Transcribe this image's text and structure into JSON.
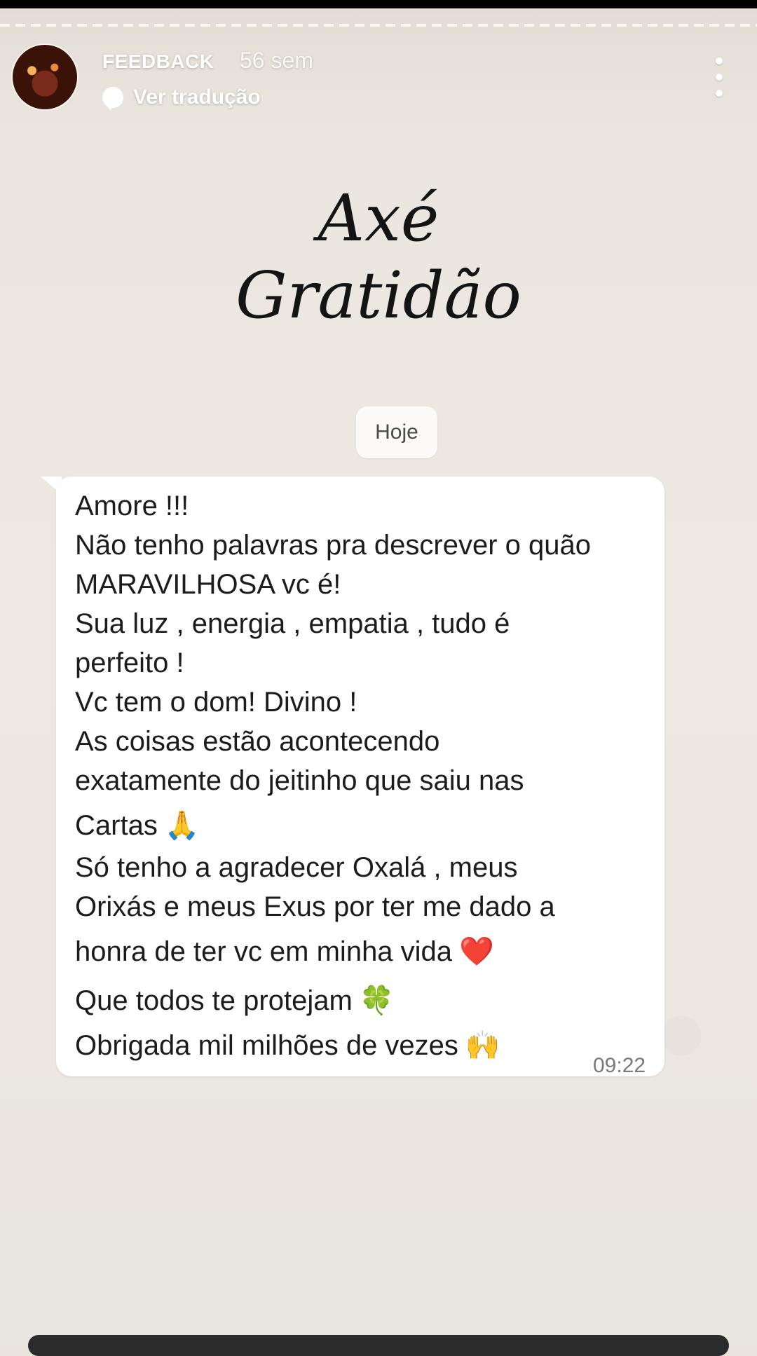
{
  "story": {
    "username": "FEEDBACK",
    "time_ago": "56 sem",
    "translate_label": "Ver tradução"
  },
  "post": {
    "headline_line1": "Axé",
    "headline_line2": "Gratidão"
  },
  "chat": {
    "date_label": "Hoje",
    "time": "09:22",
    "lines": [
      "Amore !!!",
      "Não tenho palavras pra descrever o quão",
      "MARAVILHOSA vc é!",
      "Sua luz , energia , empatia , tudo é",
      "perfeito !",
      "Vc tem o dom! Divino !",
      "As coisas estão acontecendo",
      "exatamente do jeitinho que saiu nas",
      "Cartas",
      "Só tenho a agradecer Oxalá , meus",
      "Orixás e meus Exus por ter me dado a",
      "honra de ter vc em minha vida",
      "Que todos te protejam",
      "Obrigada mil milhões de vezes"
    ],
    "emojis": {
      "pray": "🙏",
      "heart": "❤️",
      "clover": "🍀",
      "raised_hands": "🙌"
    }
  },
  "colors": {
    "background": "#ece7e1",
    "bubble": "#ffffff",
    "text": "#1c1c1c",
    "time": "#7a7a7a"
  },
  "icons": [
    "avatar",
    "translate-icon",
    "more-options-icon"
  ]
}
